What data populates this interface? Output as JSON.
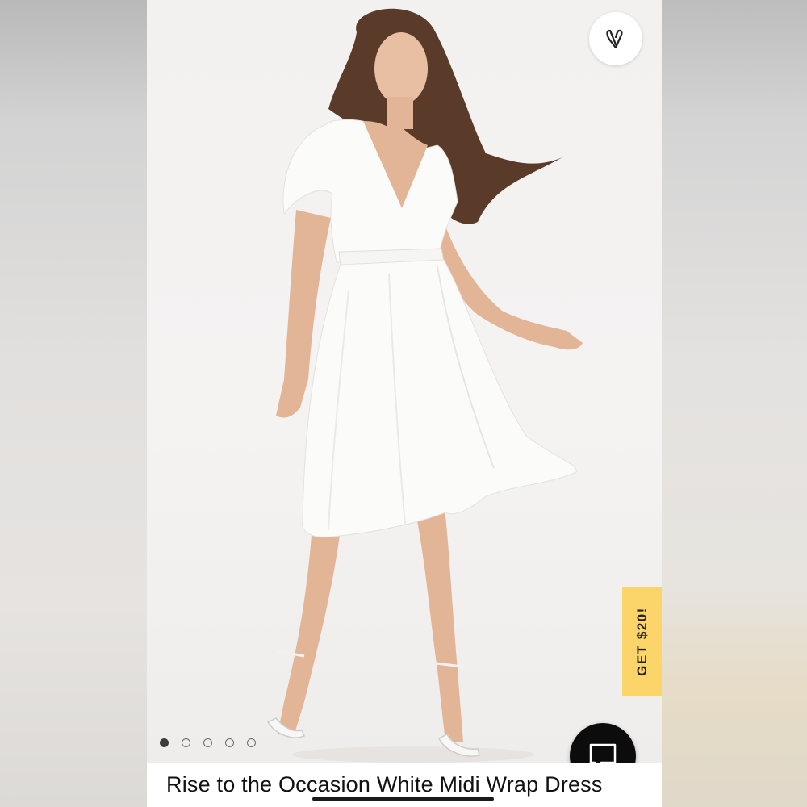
{
  "product": {
    "title": "Rise to the Occasion White Midi Wrap Dress",
    "image_alt": "Model wearing white midi wrap dress with white strappy heels"
  },
  "gallery": {
    "total_images": 5,
    "active_index": 0
  },
  "promo": {
    "label": "GET $20!",
    "color": "#fbd46a"
  },
  "favorite": {
    "icon": "heart-outline-icon"
  },
  "chat": {
    "icon": "chat-bubble-icon"
  },
  "colors": {
    "chat_bg": "#0c0c0c",
    "promo_bg": "#fbd46a",
    "dot_active": "#3d3d3d"
  }
}
